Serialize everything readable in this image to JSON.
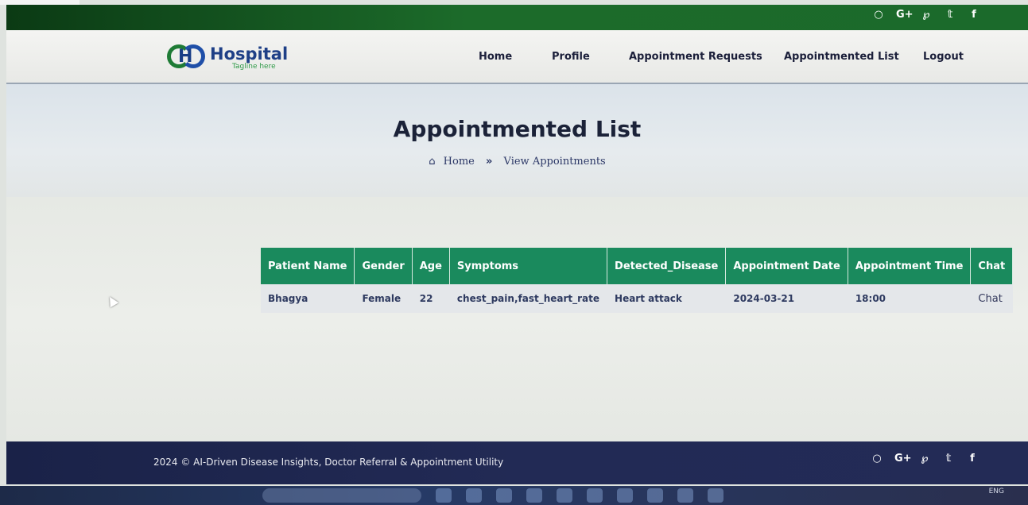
{
  "topbar": {
    "social_icons": [
      "github-icon",
      "google-plus-icon",
      "pinterest-icon",
      "twitter-icon",
      "facebook-icon"
    ],
    "glyphs": [
      "○",
      "G+",
      "℘",
      "𝕥",
      "f"
    ]
  },
  "brand": {
    "name": "Hospital",
    "tagline": "Tagline here",
    "mark": "H",
    "colors": {
      "green": "#1e7b35",
      "blue": "#1f4fa8"
    }
  },
  "nav": {
    "items": [
      {
        "label": "Home"
      },
      {
        "label": "Profile"
      },
      {
        "label": "Appointment Requests"
      },
      {
        "label": "Appointmented List"
      },
      {
        "label": "Logout"
      }
    ]
  },
  "hero": {
    "title": "Appointmented List",
    "breadcrumb": {
      "home": "Home",
      "separator": "»",
      "current": "View Appointments"
    }
  },
  "table": {
    "headers": [
      "Patient Name",
      "Gender",
      "Age",
      "Symptoms",
      "Detected_Disease",
      "Appointment Date",
      "Appointment Time",
      "Chat"
    ],
    "rows": [
      [
        "Bhagya",
        "Female",
        "22",
        "chest_pain,fast_heart_rate",
        "Heart attack",
        "2024-03-21",
        "18:00",
        "Chat"
      ]
    ],
    "header_color": "#1a8a5d"
  },
  "footer": {
    "text": "2024 © AI-Driven Disease Insights, Doctor Referral & Appointment Utility",
    "glyphs": [
      "○",
      "G+",
      "℘",
      "𝕥",
      "f"
    ]
  },
  "taskbar": {
    "language": "ENG"
  }
}
